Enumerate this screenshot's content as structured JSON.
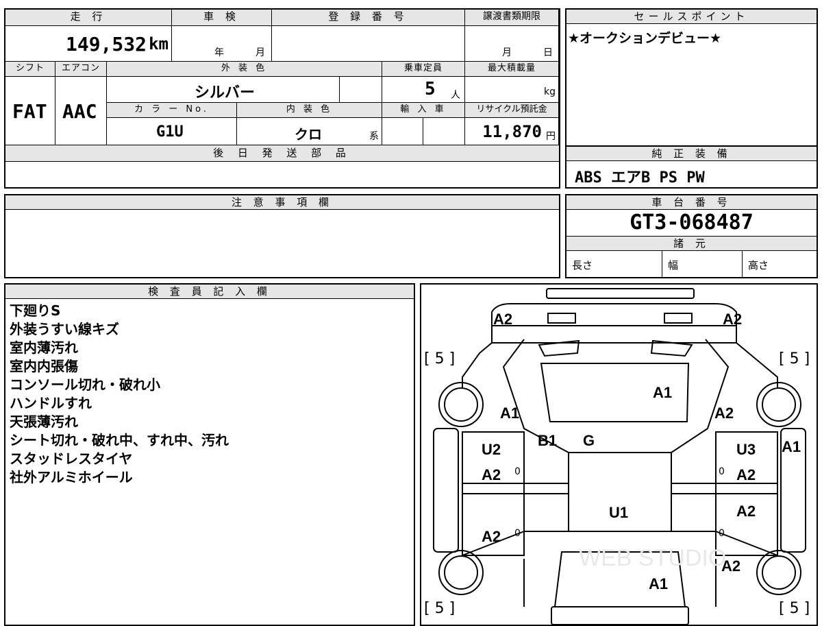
{
  "vehicle": {
    "mileage_label": "走 行",
    "mileage": "149,532",
    "mileage_unit": "km",
    "shaken_label": "車 検",
    "year_unit": "年",
    "month_unit": "月",
    "reg_label": "登 録 番 号",
    "transfer_label": "譲渡書類期限",
    "transfer_month": "月",
    "transfer_day": "日",
    "shift_label": "シフト",
    "shift": "FAT",
    "ac_label": "エアコン",
    "ac": "AAC",
    "ext_color_label": "外 装 色",
    "ext_color": "シルバー",
    "capacity_label": "乗車定員",
    "capacity": "5",
    "capacity_unit": "人",
    "max_load_label": "最大積載量",
    "max_load_unit": "kg",
    "color_no_label": "カ ラ ー No.",
    "color_no": "G1U",
    "int_color_label": "内 装 色",
    "int_color": "クロ",
    "int_color_suffix": "系",
    "import_label": "輸 入 車",
    "recycle_label": "リサイクル預託金",
    "recycle_fee": "11,870",
    "recycle_unit": "円",
    "later_parts_label": "後 日 発 送 部 品"
  },
  "sales_point": {
    "label": "セールスポイント",
    "text": "★オークションデビュー★"
  },
  "equipment": {
    "label": "純 正 装 備",
    "text": "ABS エアB PS PW"
  },
  "notes": {
    "label": "注 意 事 項 欄"
  },
  "chassis": {
    "label": "車 台 番 号",
    "number": "GT3-068487",
    "spec_label": "諸 元",
    "length_label": "長さ",
    "width_label": "幅",
    "height_label": "高さ"
  },
  "inspector": {
    "label": "検 査 員 記 入 欄",
    "remarks": [
      "下廻りS",
      "外装うすい線キズ",
      "室内薄汚れ",
      "室内内張傷",
      "コンソール切れ・破れ小",
      "ハンドルすれ",
      "天張薄汚れ",
      "シート切れ・破れ中、すれ中、汚れ",
      "スタッドレスタイヤ",
      "社外アルミホイール"
    ]
  },
  "diagram": {
    "marks": [
      "A2",
      "A2",
      "A1",
      "A1",
      "A2",
      "B1",
      "G",
      "U2",
      "U3",
      "A1",
      "A2",
      "A2",
      "U1",
      "A2",
      "A2",
      "A2",
      "A1",
      "A2"
    ],
    "tires": [
      "[ 5 ]",
      "[ 5 ]",
      "[ 5 ]",
      "[ 5 ]"
    ],
    "zero": "0",
    "watermark": "WEB STUDIO"
  }
}
